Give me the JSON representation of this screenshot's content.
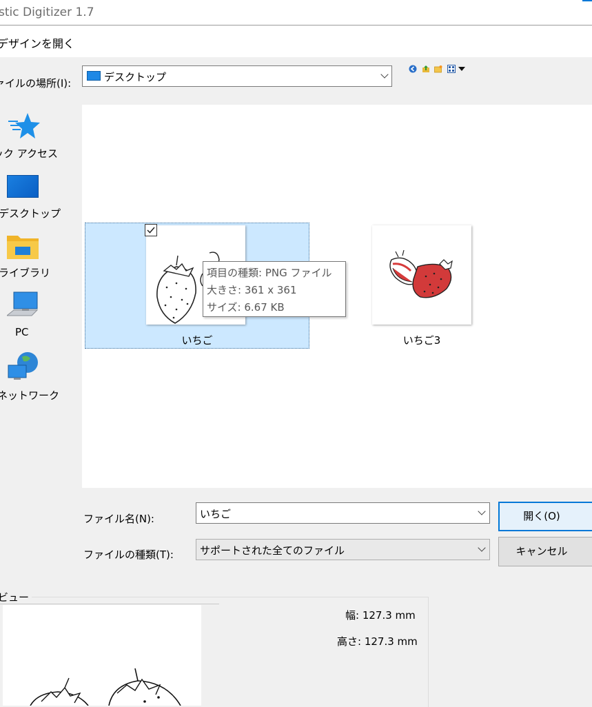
{
  "window": {
    "title": "stic Digitizer 1.7"
  },
  "dialog": {
    "title": "デザインを開く",
    "look_in": {
      "label": "ァイルの場所(I):",
      "value": "デスクトップ"
    }
  },
  "places": [
    {
      "label": "ック アクセス",
      "icon": "star-icon"
    },
    {
      "label": "デスクトップ",
      "icon": "desktop-icon"
    },
    {
      "label": "ライブラリ",
      "icon": "library-folder-icon"
    },
    {
      "label": "PC",
      "icon": "computer-icon"
    },
    {
      "label": "ネットワーク",
      "icon": "network-icon"
    }
  ],
  "files": [
    {
      "name": "いちご",
      "selected": true
    },
    {
      "name": "いちご3",
      "selected": false
    }
  ],
  "tooltip": {
    "type": "項目の種類: PNG ファイル",
    "size": "大きさ: 361 x 361",
    "filesize": "サイズ: 6.67 KB"
  },
  "filename": {
    "label": "ファイル名(N):",
    "value": "いちご"
  },
  "filetype": {
    "label": "ファイルの種類(T):",
    "value": "サポートされた全てのファイル"
  },
  "buttons": {
    "open": "開く(O)",
    "cancel": "キャンセル"
  },
  "preview": {
    "label": "ビュー",
    "width": "幅: 127.3 mm",
    "height": "高さ: 127.3 mm"
  },
  "colors": {
    "selection": "#cce8ff",
    "accent": "#0078d7",
    "strawberry": "#d63b3b"
  }
}
